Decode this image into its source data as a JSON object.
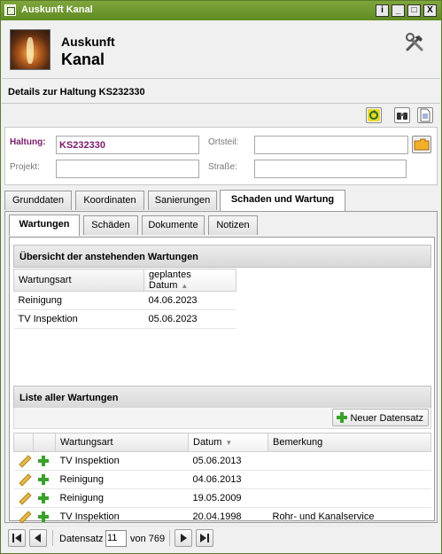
{
  "window": {
    "title": "Auskunft Kanal",
    "buttons": [
      "i",
      "_",
      "□",
      "X"
    ]
  },
  "header": {
    "line1": "Auskunft",
    "line2": "Kanal",
    "tools_icon": "hammer-wrench-icon"
  },
  "details": {
    "title": "Details zur Haltung KS232330"
  },
  "form": {
    "haltung_label": "Haltung:",
    "haltung_value": "KS232330",
    "ortsteil_label": "Ortsteil:",
    "ortsteil_value": "",
    "projekt_label": "Projekt:",
    "projekt_value": "",
    "strasse_label": "Straße:",
    "strasse_value": ""
  },
  "tabs": [
    "Grunddaten",
    "Koordinaten",
    "Sanierungen",
    "Schaden und Wartung"
  ],
  "subtabs": [
    "Wartungen",
    "Schäden",
    "Dokumente",
    "Notizen"
  ],
  "overview": {
    "title": "Übersicht der anstehenden Wartungen",
    "columns": [
      "Wartungsart",
      "geplantes Datum"
    ],
    "rows": [
      [
        "Reinigung",
        "04.06.2023"
      ],
      [
        "TV Inspektion",
        "05.06.2023"
      ]
    ]
  },
  "list": {
    "title": "Liste aller Wartungen",
    "new_button": "Neuer Datensatz",
    "columns": [
      "Wartungsart",
      "Datum",
      "Bemerkung"
    ],
    "rows": [
      [
        "TV Inspektion",
        "05.06.2013",
        ""
      ],
      [
        "Reinigung",
        "04.06.2013",
        ""
      ],
      [
        "Reinigung",
        "19.05.2009",
        ""
      ],
      [
        "TV Inspektion",
        "20.04.1998",
        "Rohr- und Kanalservice"
      ]
    ]
  },
  "pager": {
    "label": "Datensatz",
    "current": "11",
    "of_label": "von 769"
  },
  "colors": {
    "titlebar": "#6a9630",
    "required_label": "#7a1a6a",
    "add_green": "#3aa12b"
  }
}
